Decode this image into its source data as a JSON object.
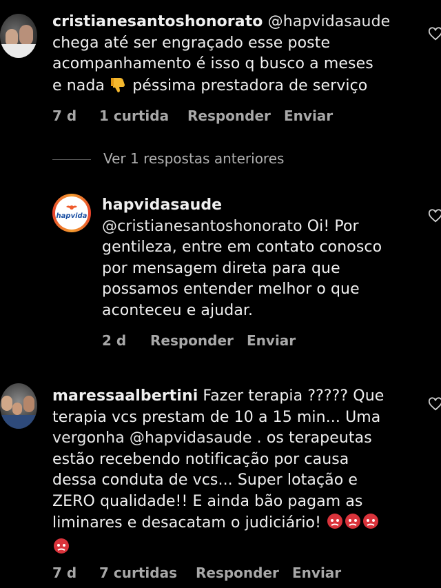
{
  "comments": [
    {
      "username": "cristianesantoshonorato",
      "mention": "@hapvidasaude",
      "text_lines": [
        "chega até ser engraçado esse poste",
        "acompanhamento é isso q busco a meses",
        "e nada",
        "péssima prestadora de serviço"
      ],
      "emoji": "thumbs-down",
      "time": "7 d",
      "likes": "1 curtida",
      "reply_label": "Responder",
      "send_label": "Enviar"
    },
    {
      "view_replies_label": "Ver 1 respostas anteriores"
    },
    {
      "username": "hapvidasaude",
      "logo_text": "hapvida",
      "mention": "@cristianesantoshonorato",
      "text_first": " Oi! Por",
      "text_lines": [
        "gentileza, entre em contato conosco",
        "por mensagem direta para que",
        "possamos entender melhor o que",
        "aconteceu e ajudar."
      ],
      "time": "2 d",
      "reply_label": "Responder",
      "send_label": "Enviar"
    },
    {
      "username": "maressaalbertini",
      "text_first": " Fazer terapia ????? Que",
      "line2": "terapia vcs prestam de 10 a 15 min... Uma",
      "line3_mention": "vergonha @hapvidasaude",
      "line3_rest": " . os terapeutas",
      "text_lines": [
        "estão recebendo notificação por causa",
        "dessa conduta de vcs... Super lotação e",
        "ZERO qualidade!! E ainda bão pagam as",
        "liminares e desacatam o judiciário!"
      ],
      "emoji": "angry-face",
      "time": "7 d",
      "likes": "7 curtidas",
      "reply_label": "Responder",
      "send_label": "Enviar"
    }
  ],
  "colors": {
    "background": "#000000",
    "text": "#f0f0f0",
    "meta": "#a8a8a8",
    "brand": "#ef5a2a"
  }
}
